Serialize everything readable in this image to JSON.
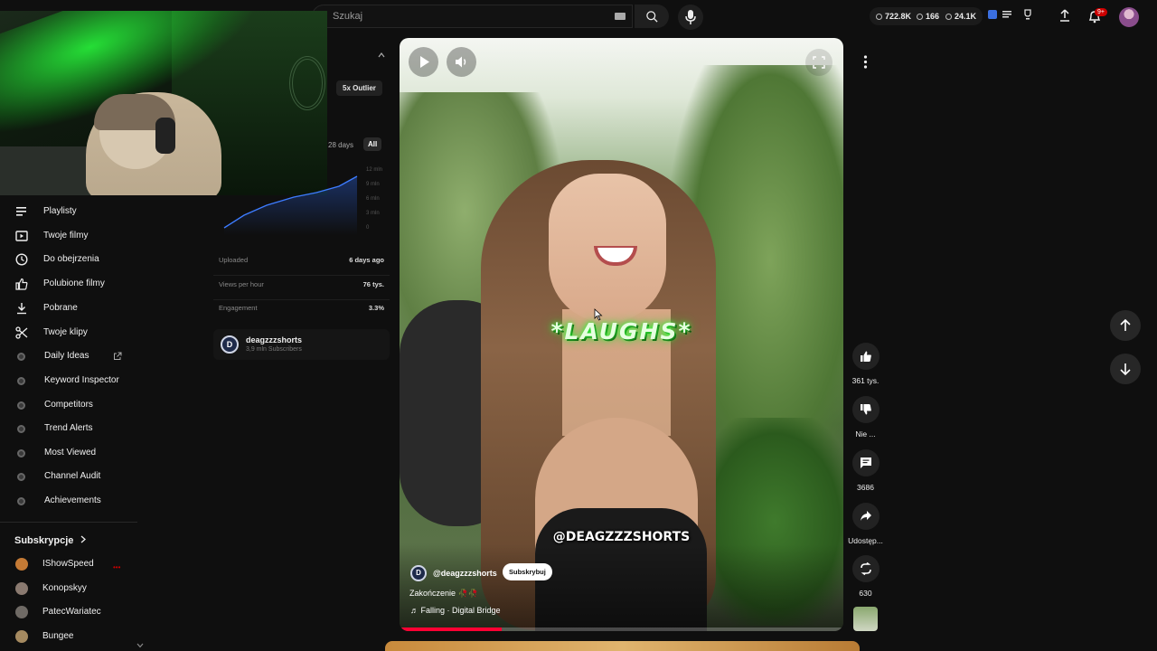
{
  "header": {
    "search_placeholder": "Szukaj",
    "stats": {
      "views": "722.8K",
      "videos": "166",
      "watch": "24.1K"
    },
    "notifications_badge": "9+"
  },
  "analytics": {
    "outlier_label": "5x Outlier",
    "range_28": "28 days",
    "range_all": "All",
    "chart_ticks": [
      "12 mln",
      "9 mln",
      "6 mln",
      "3 mln",
      "0"
    ],
    "rows": [
      {
        "key": "Uploaded",
        "value": "6 days ago"
      },
      {
        "key": "Views per hour",
        "value": "76 tys."
      },
      {
        "key": "Engagement",
        "value": "3.3%"
      }
    ],
    "channel": {
      "logo": "D",
      "name": "deagzzzshorts",
      "subs": "3,9 mln Subscribers"
    }
  },
  "sidebar": {
    "items": [
      {
        "label": "Playlisty",
        "icon": "playlist-icon"
      },
      {
        "label": "Twoje filmy",
        "icon": "video-icon"
      },
      {
        "label": "Do obejrzenia",
        "icon": "clock-icon"
      },
      {
        "label": "Polubione filmy",
        "icon": "thumb-up-icon"
      },
      {
        "label": "Pobrane",
        "icon": "download-icon"
      },
      {
        "label": "Twoje klipy",
        "icon": "scissors-icon"
      },
      {
        "label": "Daily Ideas",
        "icon": "extension-icon"
      },
      {
        "label": "Keyword Inspector",
        "icon": "extension-icon"
      },
      {
        "label": "Competitors",
        "icon": "extension-icon"
      },
      {
        "label": "Trend Alerts",
        "icon": "extension-icon"
      },
      {
        "label": "Most Viewed",
        "icon": "extension-icon"
      },
      {
        "label": "Channel Audit",
        "icon": "extension-icon"
      },
      {
        "label": "Achievements",
        "icon": "extension-icon"
      }
    ],
    "subscriptions_title": "Subskrypcje",
    "subscriptions": [
      {
        "label": "IShowSpeed",
        "color": "#c47a35"
      },
      {
        "label": "Konopskyy",
        "color": "#8a7a70"
      },
      {
        "label": "PatecWariatec",
        "color": "#6f6a65"
      },
      {
        "label": "Bungee",
        "color": "#a58a60"
      }
    ]
  },
  "short": {
    "caption": "*LAUGHS*",
    "watermark": "@DEAGZZZSHORTS",
    "channel_logo": "D",
    "channel_name": "@deagzzzshorts",
    "subscribe_label": "Subskrybuj",
    "title": "Zakończenie 🥀🥀",
    "music": "Falling · Digital Bridge",
    "progress": 0.23
  },
  "actions": {
    "likes": "361 tys.",
    "dislike": "Nie ...",
    "comments": "3686",
    "share": "Udostęp...",
    "remix": "630"
  }
}
